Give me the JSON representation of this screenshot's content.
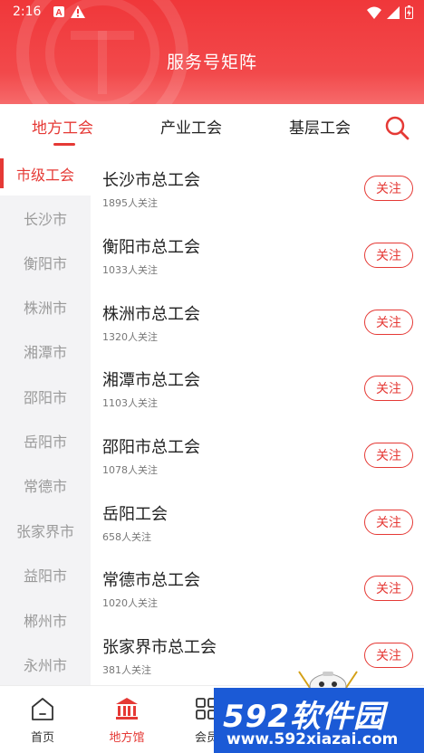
{
  "status_bar": {
    "time": "2:16",
    "left_icons": [
      "a-icon",
      "warning-icon"
    ],
    "right_icons": [
      "wifi-icon",
      "signal-icon",
      "battery-icon"
    ]
  },
  "header": {
    "title": "服务号矩阵"
  },
  "tabs": [
    {
      "label": "地方工会",
      "active": true
    },
    {
      "label": "产业工会",
      "active": false
    },
    {
      "label": "基层工会",
      "active": false
    }
  ],
  "sidebar": {
    "items": [
      {
        "label": "市级工会",
        "active": true
      },
      {
        "label": "长沙市"
      },
      {
        "label": "衡阳市"
      },
      {
        "label": "株洲市"
      },
      {
        "label": "湘潭市"
      },
      {
        "label": "邵阳市"
      },
      {
        "label": "岳阳市"
      },
      {
        "label": "常德市"
      },
      {
        "label": "张家界市"
      },
      {
        "label": "益阳市"
      },
      {
        "label": "郴州市"
      },
      {
        "label": "永州市"
      }
    ]
  },
  "list": {
    "follow_label": "关注",
    "items": [
      {
        "name": "长沙市总工会",
        "followers": "1895人关注"
      },
      {
        "name": "衡阳市总工会",
        "followers": "1033人关注"
      },
      {
        "name": "株洲市总工会",
        "followers": "1320人关注"
      },
      {
        "name": "湘潭市总工会",
        "followers": "1103人关注"
      },
      {
        "name": "邵阳市总工会",
        "followers": "1078人关注"
      },
      {
        "name": "岳阳工会",
        "followers": "658人关注"
      },
      {
        "name": "常德市总工会",
        "followers": "1020人关注"
      },
      {
        "name": "张家界市总工会",
        "followers": "381人关注"
      }
    ]
  },
  "bottom_nav": [
    {
      "label": "首页",
      "icon": "home-icon",
      "active": false
    },
    {
      "label": "地方馆",
      "icon": "building-icon",
      "active": true
    },
    {
      "label": "会员",
      "icon": "grid-icon",
      "active": false
    }
  ],
  "watermark": {
    "brand": "592软件园",
    "url": "www.592xiazai.com"
  },
  "colors": {
    "accent": "#e53935",
    "header": "#f0373a",
    "watermark": "#1b5ad6"
  }
}
